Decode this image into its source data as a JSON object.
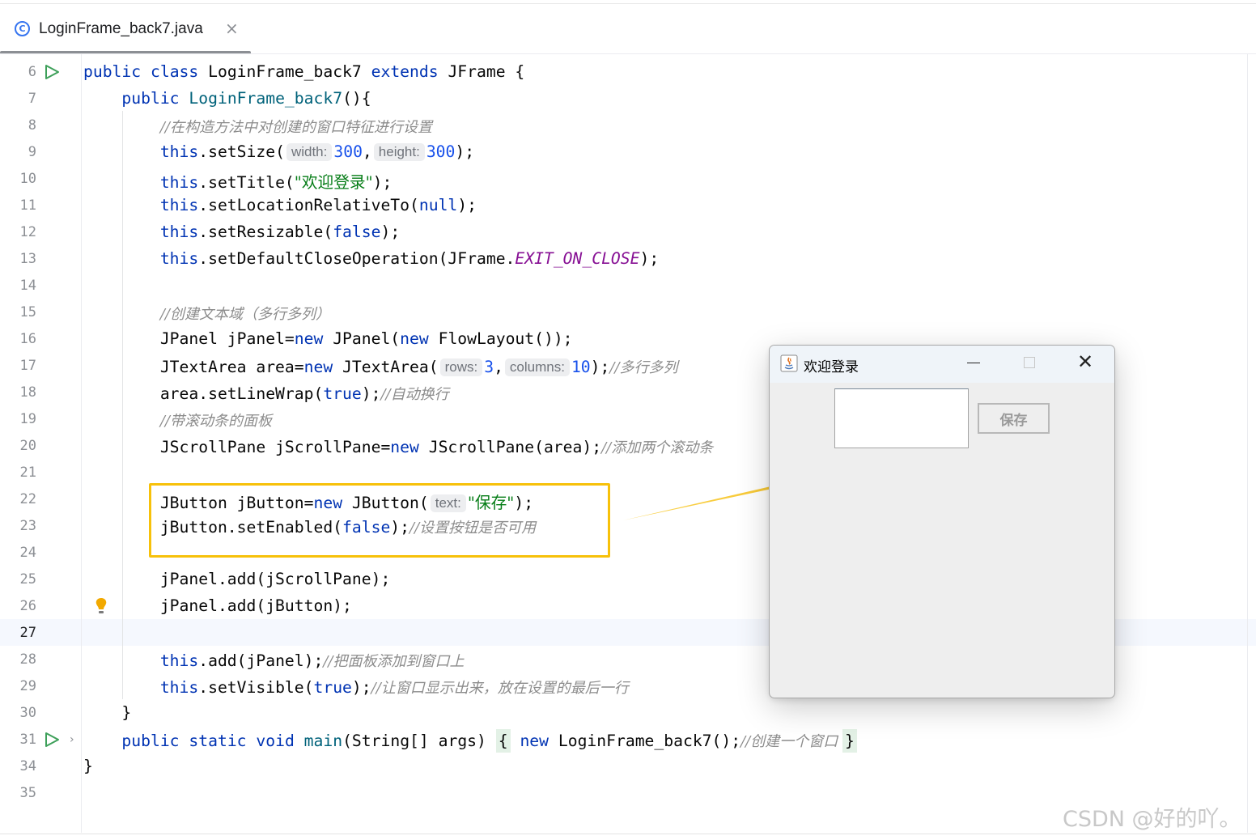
{
  "tab": {
    "icon": "java-class-icon",
    "icon_glyph": "C",
    "filename": "LoginFrame_back7.java",
    "close_glyph": "×"
  },
  "editor": {
    "lines": [
      {
        "num": "6",
        "t": [
          "kw:public ",
          "kw:class ",
          "p:LoginFrame_back7 ",
          "kw:extends ",
          "p:JFrame {"
        ]
      },
      {
        "num": "7",
        "t": [
          "p:    ",
          "kw:public ",
          "fn:LoginFrame_back7",
          "p:(){"
        ]
      },
      {
        "num": "8",
        "t": [
          "p:        ",
          "cmt://在构造方法中对创建的窗口特征进行设置"
        ]
      },
      {
        "num": "9",
        "t": [
          "p:        ",
          "kw:this",
          "p:.setSize(",
          "hint:width:",
          "num:300",
          "p:,",
          "hint:height:",
          "num:300",
          "p:);"
        ]
      },
      {
        "num": "10",
        "t": [
          "p:        ",
          "kw:this",
          "p:.setTitle(",
          "str:\"欢迎登录\"",
          "p:);"
        ]
      },
      {
        "num": "11",
        "t": [
          "p:        ",
          "kw:this",
          "p:.setLocationRelativeTo(",
          "kw:null",
          "p:);"
        ]
      },
      {
        "num": "12",
        "t": [
          "p:        ",
          "kw:this",
          "p:.setResizable(",
          "kw:false",
          "p:);"
        ]
      },
      {
        "num": "13",
        "t": [
          "p:        ",
          "kw:this",
          "p:.setDefaultCloseOperation(JFrame.",
          "const:EXIT_ON_CLOSE",
          "p:);"
        ]
      },
      {
        "num": "14",
        "t": []
      },
      {
        "num": "15",
        "t": [
          "p:        ",
          "cmt://创建文本域（多行多列）"
        ]
      },
      {
        "num": "16",
        "t": [
          "p:        JPanel jPanel=",
          "kw:new ",
          "p:JPanel(",
          "kw:new ",
          "p:FlowLayout());"
        ]
      },
      {
        "num": "17",
        "t": [
          "p:        JTextArea area=",
          "kw:new ",
          "p:JTextArea(",
          "hint:rows:",
          "num:3",
          "p:,",
          "hint:columns:",
          "num:10",
          "p:);",
          "cmt://多行多列"
        ]
      },
      {
        "num": "18",
        "t": [
          "p:        area.setLineWrap(",
          "kw:true",
          "p:);",
          "cmt://自动换行"
        ]
      },
      {
        "num": "19",
        "t": [
          "p:        ",
          "cmt://带滚动条的面板"
        ]
      },
      {
        "num": "20",
        "t": [
          "p:        JScrollPane jScrollPane=",
          "kw:new ",
          "p:JScrollPane(area);",
          "cmt://添加两个滚动条"
        ]
      },
      {
        "num": "21",
        "t": []
      },
      {
        "num": "22",
        "t": [
          "p:        JButton jButton=",
          "kw:new ",
          "p:JButton(",
          "hint:text:",
          "str:\"保存\"",
          "p:);"
        ]
      },
      {
        "num": "23",
        "t": [
          "p:        jButton.setEnabled(",
          "kw:false",
          "p:);",
          "cmt://设置按钮是否可用"
        ]
      },
      {
        "num": "24",
        "t": []
      },
      {
        "num": "25",
        "t": [
          "p:        jPanel.add(jScrollPane);"
        ]
      },
      {
        "num": "26",
        "t": [
          "p:        jPanel.add(jButton);"
        ]
      },
      {
        "num": "27",
        "t": []
      },
      {
        "num": "28",
        "t": [
          "p:        ",
          "kw:this",
          "p:.add(jPanel);",
          "cmt://把面板添加到窗口上"
        ]
      },
      {
        "num": "29",
        "t": [
          "p:        ",
          "kw:this",
          "p:.setVisible(",
          "kw:true",
          "p:);",
          "cmt://让窗口显示出来，放在设置的最后一行"
        ]
      },
      {
        "num": "30",
        "t": [
          "p:    }"
        ]
      },
      {
        "num": "31",
        "t": [
          "p:    ",
          "kw:public ",
          "kw:static ",
          "kw:void ",
          "fn:main",
          "p:(String[] args) ",
          "br:{",
          "p: ",
          "kw:new ",
          "p:LoginFrame_back7();",
          "cmt://创建一个窗口 ",
          "br:}"
        ]
      },
      {
        "num": "34",
        "t": [
          "p:}"
        ]
      },
      {
        "num": "35",
        "t": []
      }
    ],
    "active_line": "27",
    "run_lines": [
      "6",
      "31"
    ],
    "folded_lines": [
      "31"
    ],
    "bulb_line": "26",
    "highlight_lines": [
      "22",
      "23"
    ]
  },
  "dialog": {
    "icon": "java-app-icon",
    "title": "欢迎登录",
    "minimize_icon": "minimize-icon",
    "maximize_icon": "maximize-icon",
    "close_glyph": "✕",
    "button_label": "保存",
    "button_enabled": false
  },
  "annotation": {
    "color": "#f7c10a"
  },
  "watermark": "CSDN @好的吖。",
  "colors": {
    "keyword": "#0033b3",
    "method": "#00627a",
    "number": "#1750eb",
    "string": "#067d17",
    "comment": "#8c8c8c",
    "constant": "#871094",
    "run": "#3ea05a",
    "bulb": "#f2a900"
  }
}
